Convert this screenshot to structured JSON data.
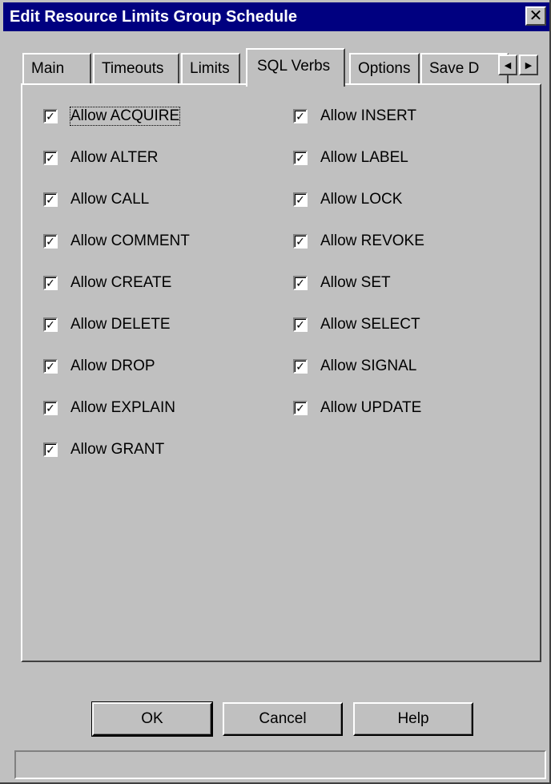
{
  "window": {
    "title": "Edit Resource Limits Group Schedule",
    "close_glyph": "✕"
  },
  "tabs": [
    {
      "label": "Main"
    },
    {
      "label": "Timeouts"
    },
    {
      "label": "Limits"
    },
    {
      "label": "SQL Verbs",
      "active": true
    },
    {
      "label": "Options"
    },
    {
      "label": "Save D"
    }
  ],
  "tab_scroll": {
    "left_glyph": "◀",
    "right_glyph": "▶"
  },
  "checkboxes_left": [
    {
      "label": "Allow ACQUIRE",
      "checked": true
    },
    {
      "label": "Allow ALTER",
      "checked": true
    },
    {
      "label": "Allow CALL",
      "checked": true
    },
    {
      "label": "Allow COMMENT",
      "checked": true
    },
    {
      "label": "Allow CREATE",
      "checked": true
    },
    {
      "label": "Allow DELETE",
      "checked": true
    },
    {
      "label": "Allow DROP",
      "checked": true
    },
    {
      "label": "Allow EXPLAIN",
      "checked": true
    },
    {
      "label": "Allow GRANT",
      "checked": true
    }
  ],
  "checkboxes_right": [
    {
      "label": "Allow INSERT",
      "checked": true
    },
    {
      "label": "Allow LABEL",
      "checked": true
    },
    {
      "label": "Allow LOCK",
      "checked": true
    },
    {
      "label": "Allow REVOKE",
      "checked": true
    },
    {
      "label": "Allow SET",
      "checked": true
    },
    {
      "label": "Allow SELECT",
      "checked": true
    },
    {
      "label": "Allow SIGNAL",
      "checked": true
    },
    {
      "label": "Allow UPDATE",
      "checked": true
    }
  ],
  "check_glyph": "✓",
  "buttons": {
    "ok_label": "OK",
    "cancel_label": "Cancel",
    "help_label": "Help"
  },
  "statusbar": {
    "text": ""
  }
}
